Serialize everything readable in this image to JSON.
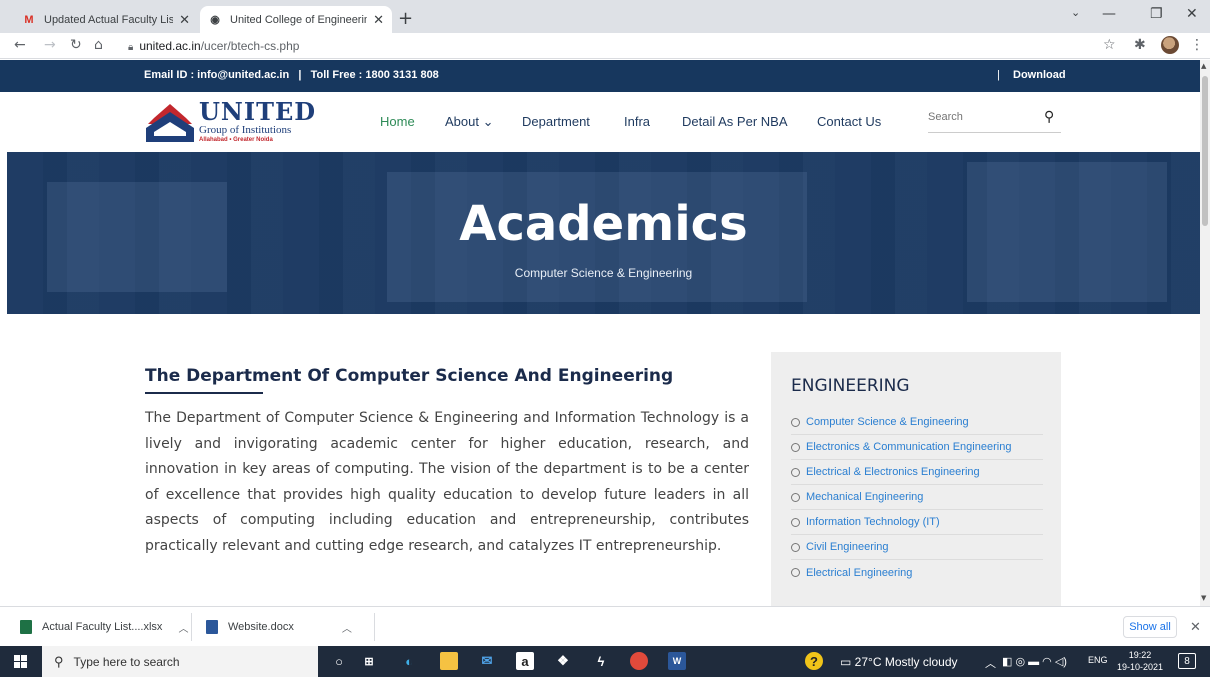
{
  "browser": {
    "tabs": [
      {
        "title": "Updated Actual Faculty List - pra",
        "active": false,
        "icon": "gmail-icon"
      },
      {
        "title": "United College of Engineering &",
        "active": true,
        "icon": "globe-icon"
      }
    ],
    "url_host": "united.ac.in",
    "url_path": "/ucer/btech-cs.php"
  },
  "page": {
    "topbar": {
      "contact": "Email ID : info@united.ac.in   |   Toll Free : 1800 3131 808",
      "download_sep": "|",
      "download": "Download"
    },
    "logo": {
      "name": "UNITED",
      "subtitle": "Group of Institutions",
      "locations": "Allahabad • Greater Noida"
    },
    "nav": {
      "home": "Home",
      "about": "About ⌄",
      "department": "Department",
      "infra": "Infra",
      "nba": "Detail As Per NBA",
      "contact": "Contact Us",
      "search_placeholder": "Search"
    },
    "hero": {
      "title": "Academics",
      "subtitle": "Computer Science & Engineering"
    },
    "department": {
      "title": "The Department Of Computer Science And Engineering",
      "paragraph": "The Department of Computer Science & Engineering and Information Technology is a lively and invigorating academic center for higher education, research, and innovation in key areas of computing. The vision of the department is to be a center of excellence that provides high quality education to develop future leaders in all aspects of computing including education and entrepreneurship, contributes practically relevant and cutting edge research, and catalyzes IT entrepreneurship."
    },
    "sidebar": {
      "heading": "ENGINEERING",
      "items": [
        "Computer Science & Engineering",
        "Electronics & Communication Engineering",
        "Electrical & Electronics Engineering",
        "Mechanical Engineering",
        "Information Technology (IT)",
        "Civil Engineering",
        "Electrical Engineering"
      ]
    }
  },
  "downloads": {
    "items": [
      {
        "name": "Actual Faculty List....xlsx",
        "color": "#1e7145"
      },
      {
        "name": "Website.docx",
        "color": "#2b579a"
      }
    ],
    "show_all": "Show all"
  },
  "taskbar": {
    "search_placeholder": "Type here to search",
    "weather": "27°C  Mostly cloudy",
    "lang": "ENG",
    "time": "19:22",
    "date": "19-10-2021",
    "notifications": "8"
  },
  "colors": {
    "navy": "#17375e",
    "nav_home": "#2e8b57",
    "link_blue": "#2b7fd1"
  }
}
